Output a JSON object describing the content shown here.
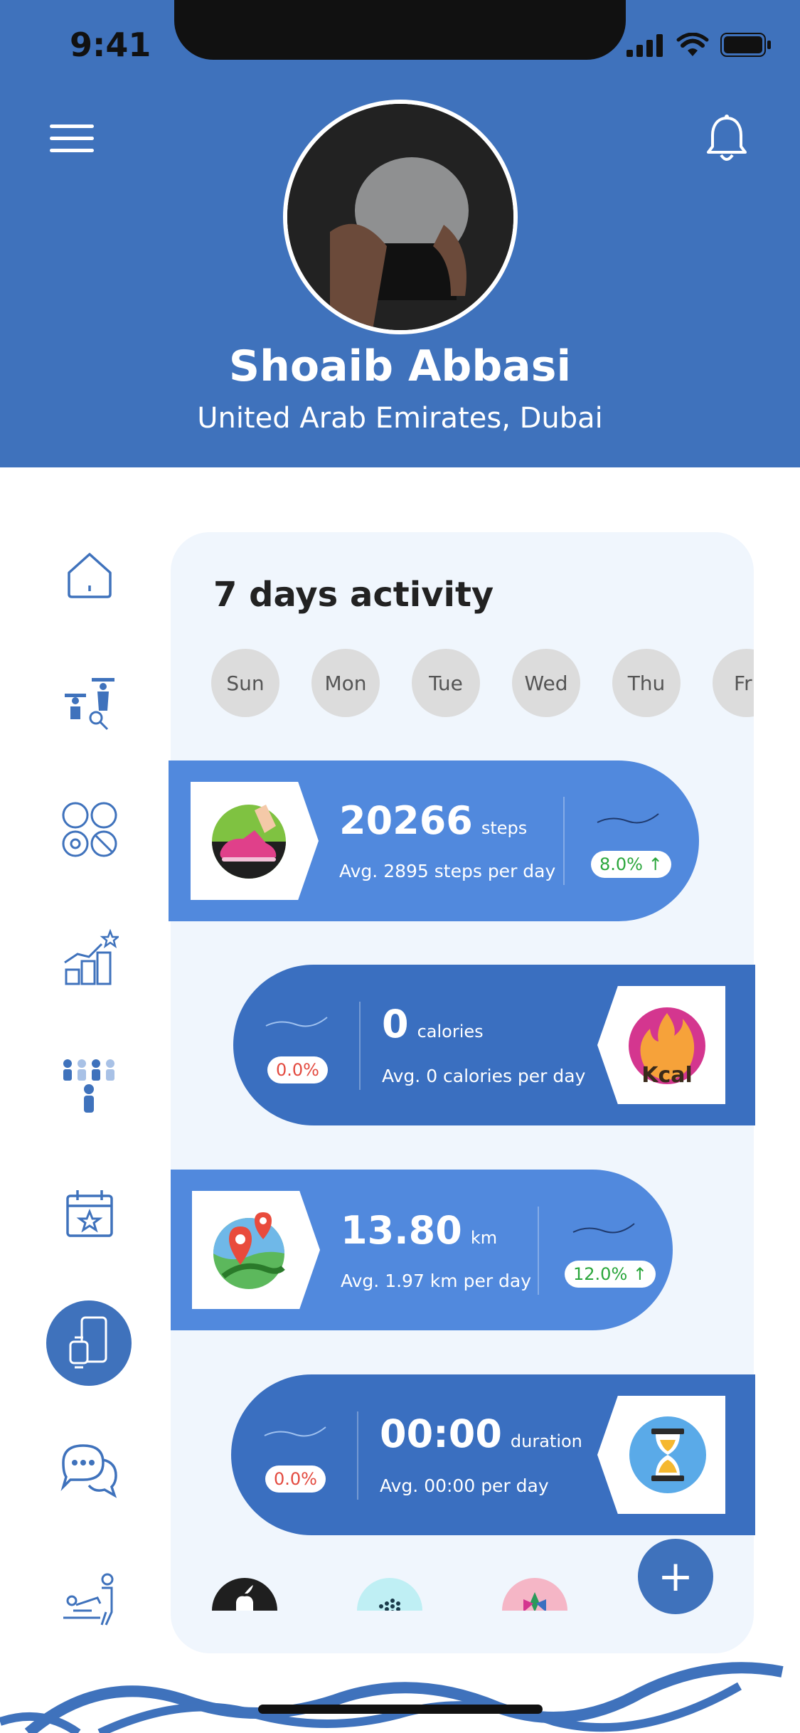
{
  "status_bar": {
    "time": "9:41"
  },
  "profile": {
    "name": "Shoaib Abbasi",
    "location": "United Arab Emirates, Dubai"
  },
  "panel": {
    "title": "7 days activity",
    "days": [
      "Sun",
      "Mon",
      "Tue",
      "Wed",
      "Thu",
      "Fr"
    ]
  },
  "metrics": {
    "steps": {
      "value": "20266",
      "unit": "steps",
      "avg": "Avg. 2895 steps per day",
      "change": "8.0% ↑"
    },
    "calories": {
      "value": "0",
      "unit": "calories",
      "avg": "Avg. 0 calories per day",
      "change": "0.0%",
      "icon_label": "Kcal"
    },
    "distance": {
      "value": "13.80",
      "unit": "km",
      "avg": "Avg. 1.97 km per day",
      "change": "12.0% ↑"
    },
    "duration": {
      "value": "00:00",
      "unit": "duration",
      "avg": "Avg. 00:00 per day",
      "change": "0.0%"
    }
  },
  "fab": {
    "label": "+"
  },
  "sidebar_icons": [
    "home-icon",
    "workout-icon",
    "sports-icon",
    "progress-icon",
    "community-icon",
    "calendar-icon",
    "device-icon",
    "chat-icon",
    "physio-icon"
  ],
  "colors": {
    "brand": "#3f72bc",
    "card_light": "#5189dd",
    "card_dark": "#3a6fc0",
    "up": "#2aa63b",
    "down": "#e34a3f"
  }
}
